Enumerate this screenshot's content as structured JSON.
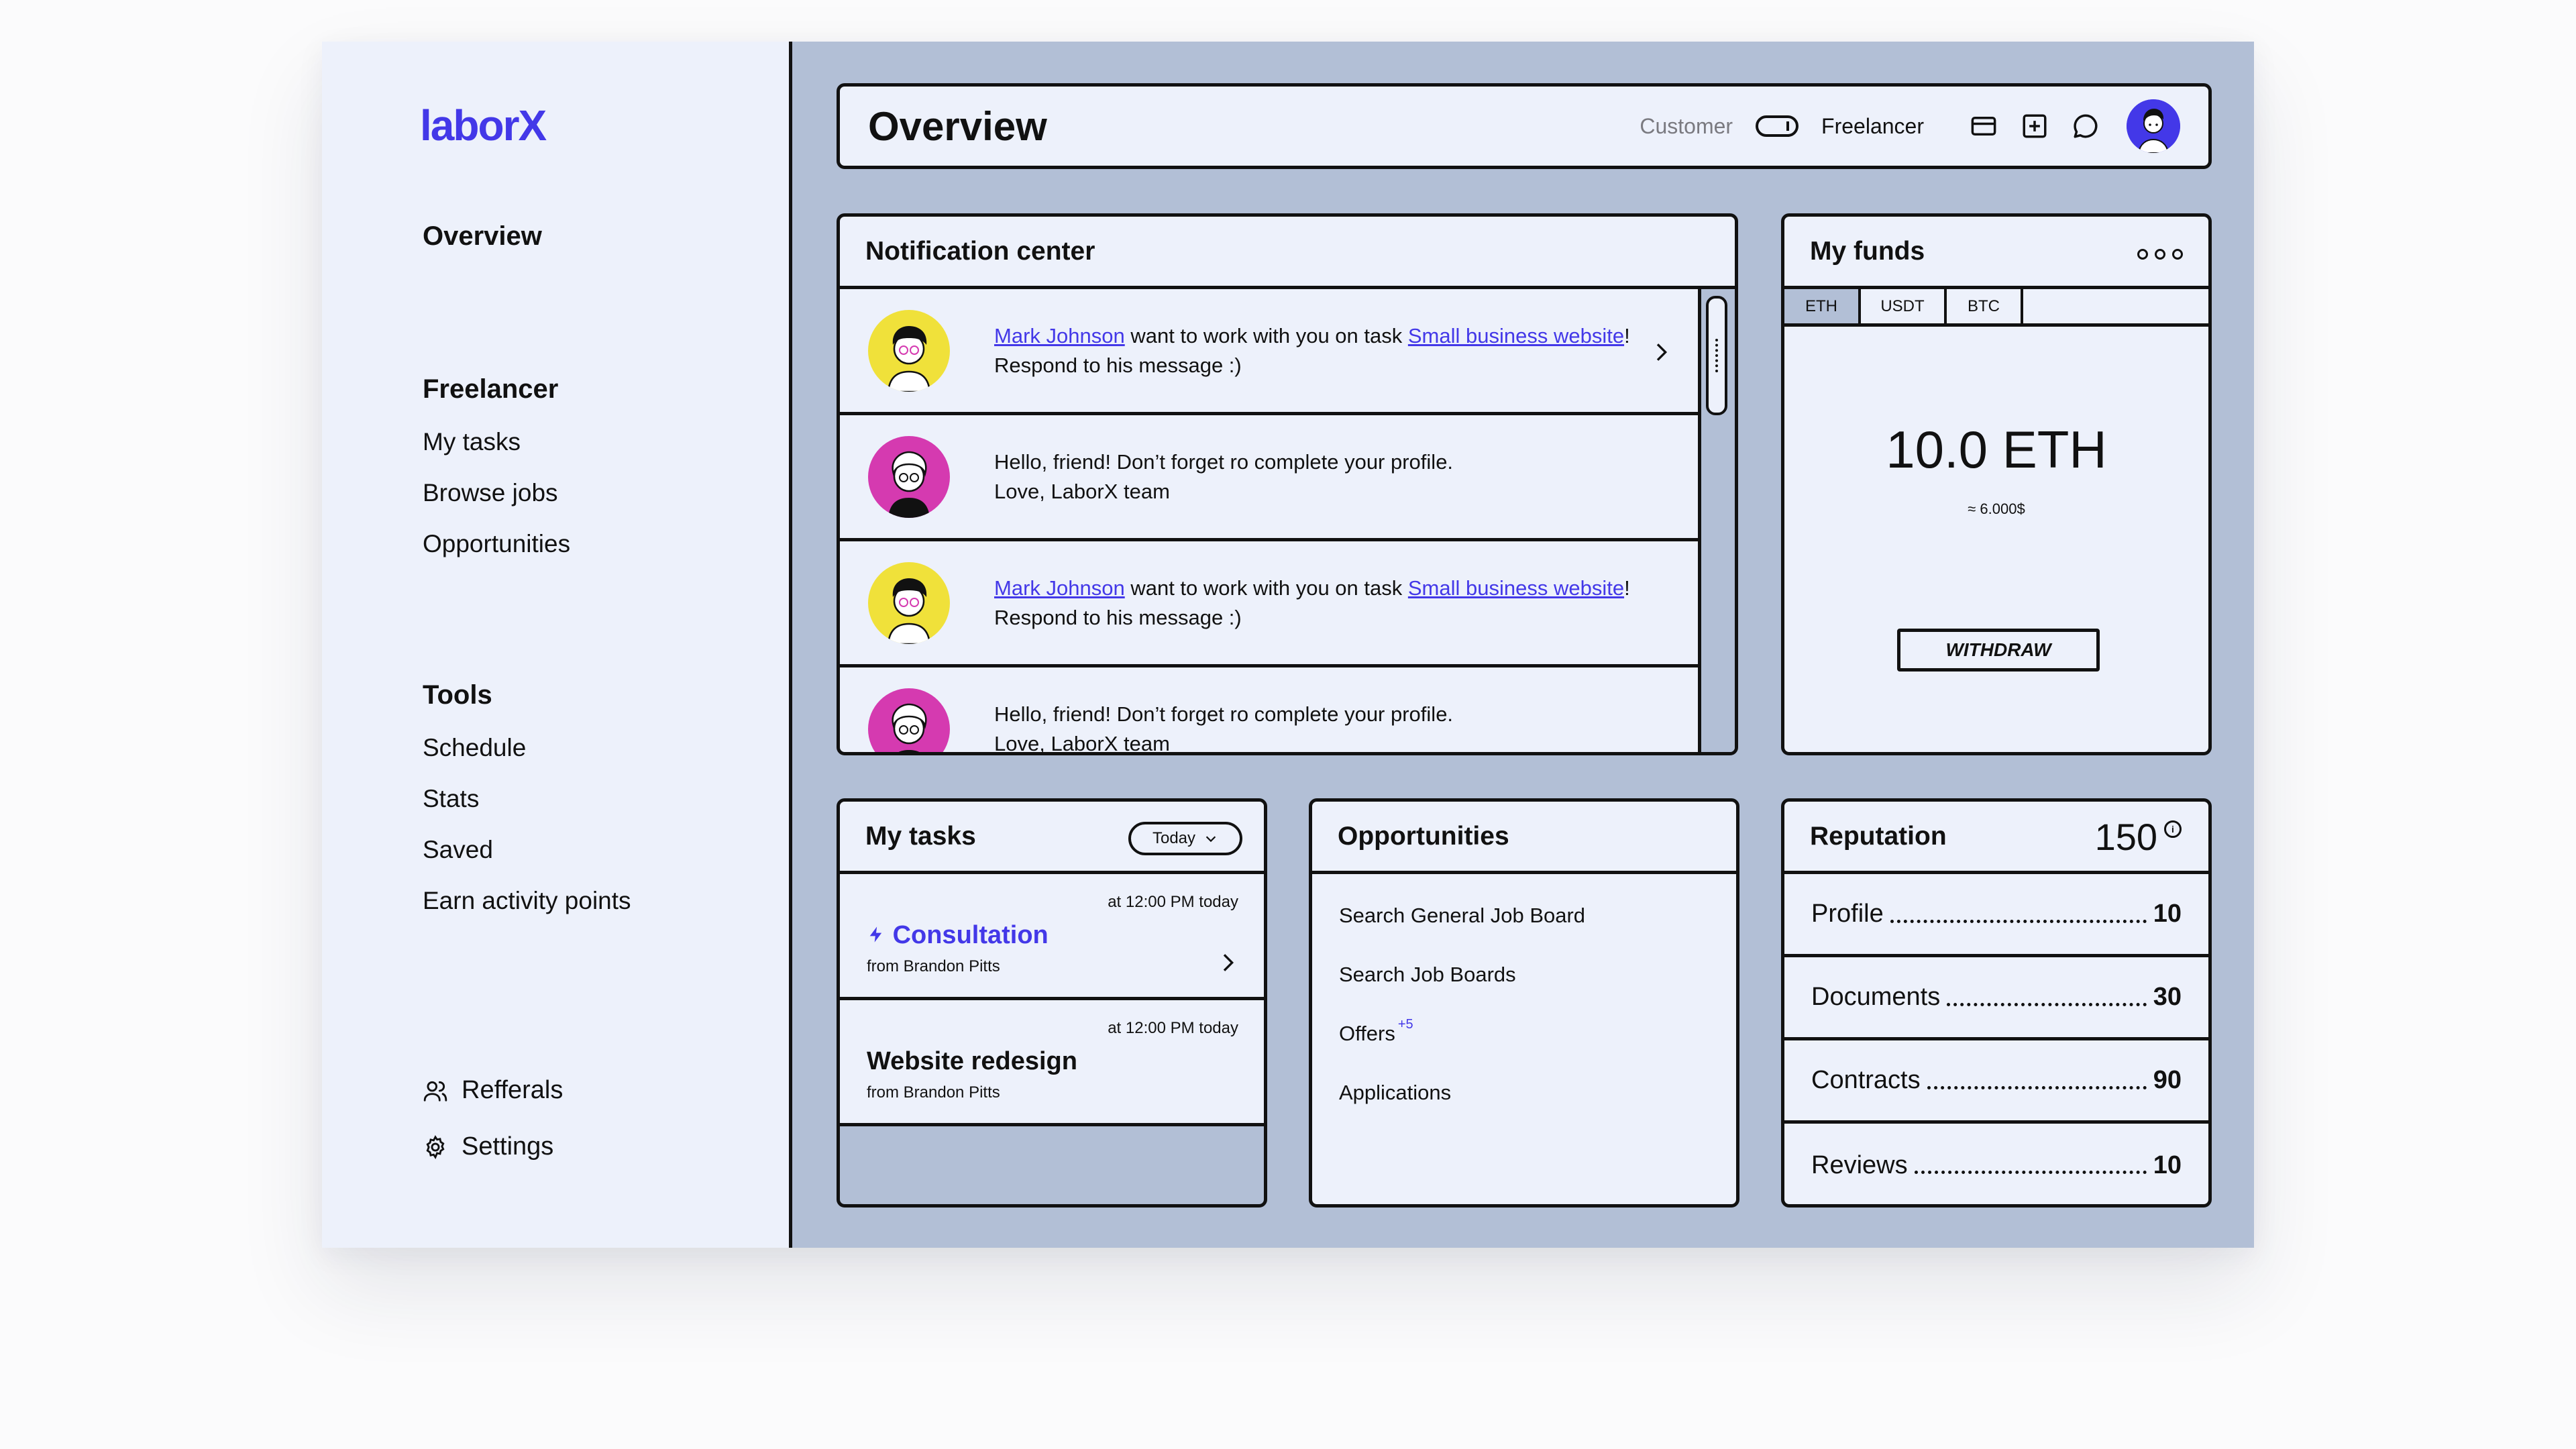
{
  "app": {
    "logo": "laborX"
  },
  "sidebar": {
    "overview": "Overview",
    "freelancer_heading": "Freelancer",
    "freelancer_items": [
      "My tasks",
      "Browse jobs",
      "Opportunities"
    ],
    "tools_heading": "Tools",
    "tools_items": [
      "Schedule",
      "Stats",
      "Saved",
      "Earn activity points"
    ],
    "referrals": "Refferals",
    "settings": "Settings"
  },
  "header": {
    "title": "Overview",
    "role_customer": "Customer",
    "role_freelancer": "Freelancer",
    "icons": [
      "card-icon",
      "add-square-icon",
      "chat-icon"
    ]
  },
  "notifications": {
    "title": "Notification center",
    "items": [
      {
        "name": "Mark Johnson",
        "mid": " want to work with you on task ",
        "task": "Small business website",
        "end": "!",
        "line2": "Respond to his message :)"
      },
      {
        "line1": "Hello, friend! Don’t forget ro complete your profile.",
        "line2": "Love, LaborX team"
      },
      {
        "name": "Mark Johnson",
        "mid": " want to work with you on task ",
        "task": "Small business website",
        "end": "!",
        "line2": "Respond to his message :)"
      },
      {
        "line1": "Hello, friend! Don’t forget ro complete your profile.",
        "line2": "Love, LaborX team"
      }
    ]
  },
  "funds": {
    "title": "My funds",
    "tabs": [
      "ETH",
      "USDT",
      "BTC"
    ],
    "active_tab": "ETH",
    "balance": "10.0 ETH",
    "approx": "≈ 6.000$",
    "withdraw": "WITHDRAW"
  },
  "tasks": {
    "title": "My tasks",
    "filter": "Today",
    "items": [
      {
        "time": "at 12:00 PM today",
        "title": "Consultation",
        "from": "from Brandon Pitts"
      },
      {
        "time": "at 12:00 PM today",
        "title": "Website redesign",
        "from": "from Brandon Pitts"
      }
    ]
  },
  "opportunities": {
    "title": "Opportunities",
    "items": [
      "Search General Job Board",
      "Search Job Boards",
      "Offers",
      "Applications"
    ],
    "offers_badge": "+5"
  },
  "reputation": {
    "title": "Reputation",
    "score": "150",
    "info": "i",
    "rows": [
      {
        "label": "Profile",
        "value": "10"
      },
      {
        "label": "Documents",
        "value": "30"
      },
      {
        "label": "Contracts",
        "value": "90"
      },
      {
        "label": "Reviews",
        "value": "10"
      }
    ]
  },
  "colors": {
    "accent": "#4338e8",
    "panel_bg": "#edf1fb",
    "main_bg": "#b2bfd6",
    "avatar_yellow": "#f0e13a",
    "avatar_pink": "#d53ab0"
  }
}
